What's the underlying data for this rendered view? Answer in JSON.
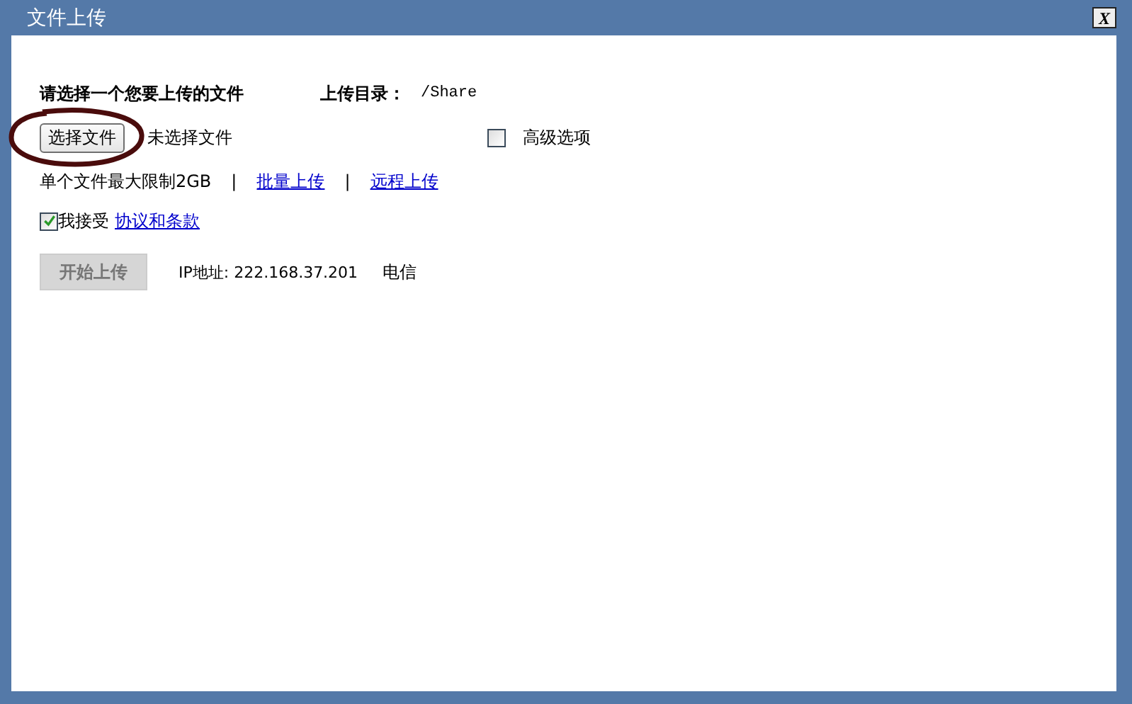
{
  "window": {
    "title": "文件上传",
    "close": "X"
  },
  "heading": "请选择一个您要上传的文件",
  "directory": {
    "label": "上传目录：",
    "value": "/Share"
  },
  "file_picker": {
    "button": "选择文件",
    "status": "未选择文件"
  },
  "advanced": {
    "label": "高级选项",
    "checked": false
  },
  "limit_row": [
    {
      "kind": "text",
      "text": "单个文件最大限制2GB"
    },
    {
      "kind": "separator",
      "text": "|"
    },
    {
      "kind": "link",
      "text": "批量上传"
    },
    {
      "kind": "separator",
      "text": "|"
    },
    {
      "kind": "link",
      "text": "远程上传"
    }
  ],
  "agreement": {
    "checked": true,
    "label": "我接受",
    "link": "协议和条款"
  },
  "upload": {
    "button": "开始上传",
    "disabled": true
  },
  "ip_info": "IP地址: 222.168.37.201",
  "isp": "电信",
  "annotation": {
    "kind": "circle"
  }
}
